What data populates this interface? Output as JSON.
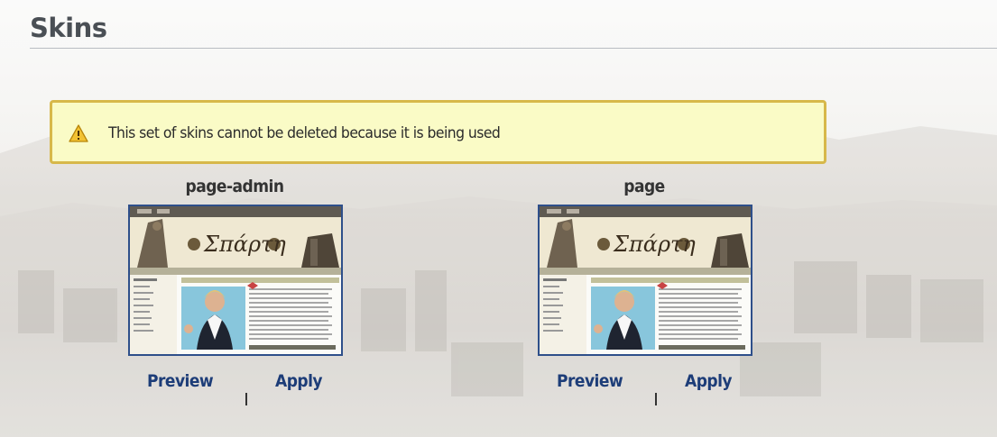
{
  "page": {
    "title": "Skins"
  },
  "alert": {
    "icon": "warning-icon",
    "message": "This set of skins cannot be deleted because it is being used",
    "background": "#fafbc6",
    "border": "#d7b84a"
  },
  "skins": [
    {
      "name": "page-admin",
      "thumbnail_text": "Σπάρτη",
      "preview_label": "Preview",
      "apply_label": "Apply"
    },
    {
      "name": "page",
      "thumbnail_text": "Σπάρτη",
      "preview_label": "Preview",
      "apply_label": "Apply"
    }
  ],
  "colors": {
    "link": "#1d3d78",
    "thumbnail_border": "#2e4f8a",
    "title": "#4a4f55"
  }
}
